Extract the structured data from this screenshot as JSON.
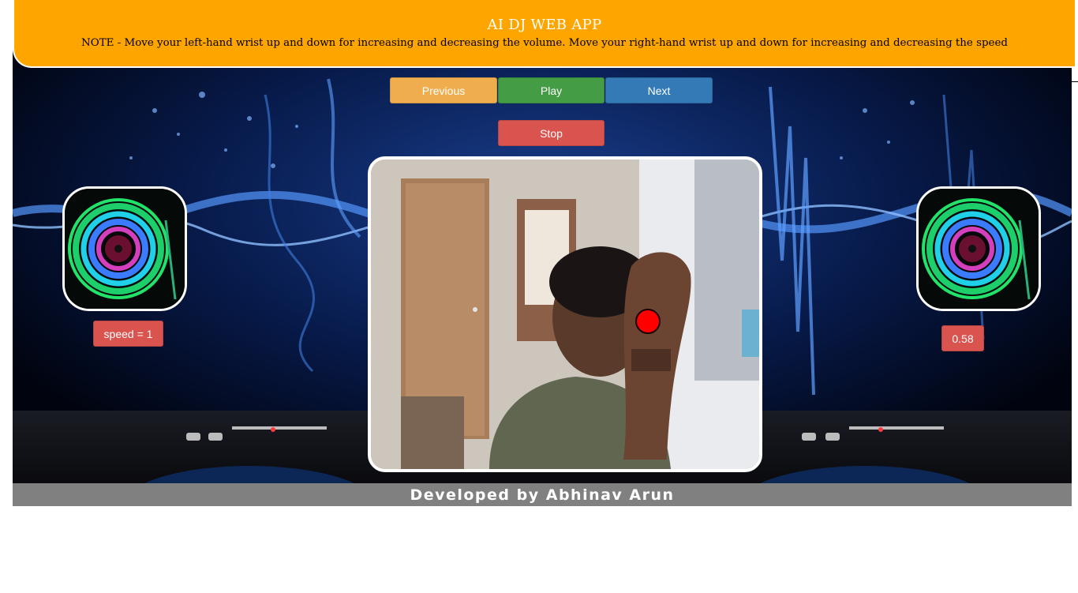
{
  "header": {
    "title": "AI DJ WEB APP",
    "note": "NOTE - Move your left-hand wrist up and down for increasing and decreasing the volume. Move your right-hand wrist up and down for increasing and decreasing the speed"
  },
  "controls": {
    "previous_label": "Previous",
    "play_label": "Play",
    "next_label": "Next",
    "stop_label": "Stop"
  },
  "status": {
    "speed": "speed = 1",
    "volume": "0.58"
  },
  "footer": {
    "credit": "Developed by Abhinav Arun"
  },
  "colors": {
    "header_bg": "#ffa500",
    "previous": "#f0ad4e",
    "play": "#449d44",
    "next": "#337ab7",
    "stop": "#d9534f",
    "badge": "#d9534f",
    "wrist_marker": "#ff0000",
    "footer_bg": "#808080"
  },
  "icons": {
    "disc_left": "dj-turntable-disc-icon",
    "disc_right": "dj-turntable-disc-icon"
  }
}
